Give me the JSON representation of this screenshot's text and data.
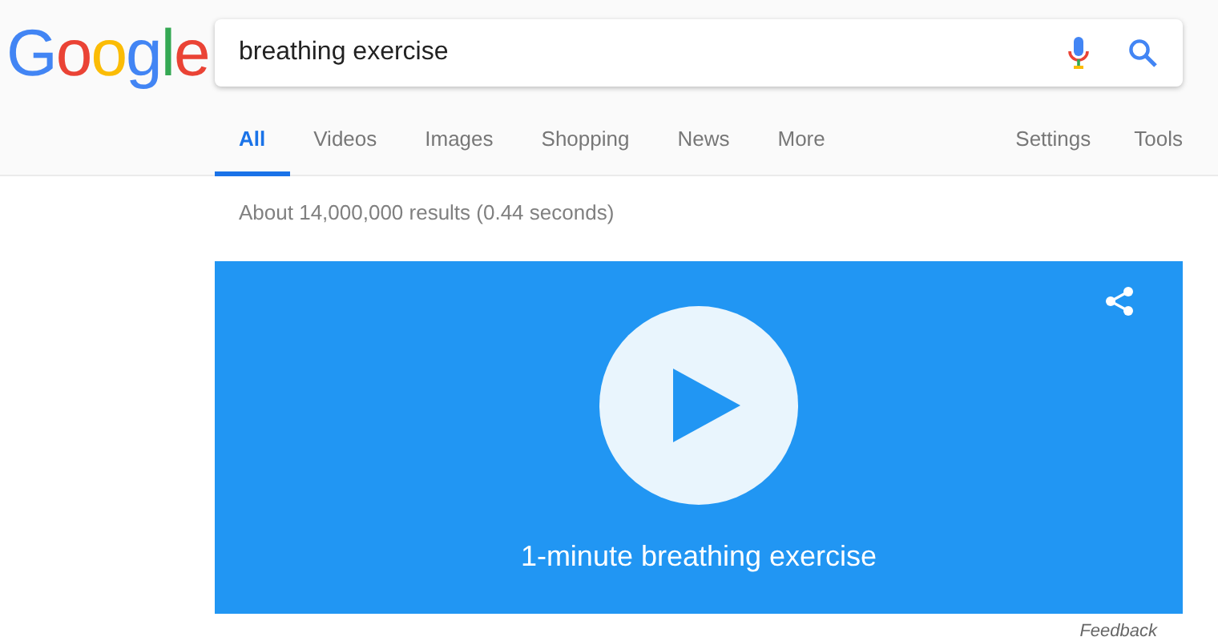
{
  "logo": "Google",
  "search": {
    "value": "breathing exercise"
  },
  "tabs": [
    {
      "label": "All",
      "selected": true
    },
    {
      "label": "Videos",
      "selected": false
    },
    {
      "label": "Images",
      "selected": false
    },
    {
      "label": "Shopping",
      "selected": false
    },
    {
      "label": "News",
      "selected": false
    },
    {
      "label": "More",
      "selected": false
    }
  ],
  "right_tabs": [
    "Settings",
    "Tools"
  ],
  "result_stats": "About 14,000,000 results (0.44 seconds)",
  "video_card": {
    "title": "1-minute breathing exercise"
  },
  "feedback": "Feedback"
}
